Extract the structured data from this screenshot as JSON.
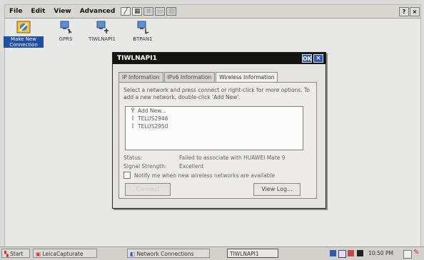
{
  "menubar": {
    "items": [
      "File",
      "Edit",
      "View",
      "Advanced"
    ],
    "help_label": "?",
    "close_label": "×"
  },
  "desktop_icons": [
    {
      "label": "Make New Connection",
      "icon": "make-connection-icon"
    },
    {
      "label": "GPRS",
      "icon": "network-connection-icon"
    },
    {
      "label": "TIWLNAPI1",
      "icon": "network-connection-icon"
    },
    {
      "label": "BTPAN1",
      "icon": "network-connection-icon"
    }
  ],
  "dialog": {
    "title": "TIWLNAPI1",
    "ok_label": "OK",
    "close_label": "×",
    "tabs": [
      "IP Information",
      "IPv6 Information",
      "Wireless Information"
    ],
    "active_tab": "Wireless Information",
    "instructions": "Select a network and press connect or right-click for more options.  To add a new network, double-click 'Add New'.",
    "networks": [
      {
        "name": "Add New...",
        "icon": "antenna-icon"
      },
      {
        "name": "TELUS2946",
        "icon": "signal-icon"
      },
      {
        "name": "TELUS2950",
        "icon": "signal-icon"
      }
    ],
    "status_label": "Status:",
    "status_value": "Failed to associate with HUAWEI Mate 9",
    "signal_label": "Signal Strength:",
    "signal_value": "Excellent",
    "notify_label": "Notify me when new wireless networks are available",
    "connect_label": "Connect",
    "viewlog_label": "View Log..."
  },
  "taskbar": {
    "start_label": "Start",
    "tasks": [
      "LeicaCapturate",
      "Network Connections",
      "TIWLNAPI1"
    ],
    "clock": "10:50 PM"
  },
  "colors": {
    "title_bar": "#141414",
    "selection": "#1f4fa8",
    "accent_button": "#2c5bb3"
  }
}
